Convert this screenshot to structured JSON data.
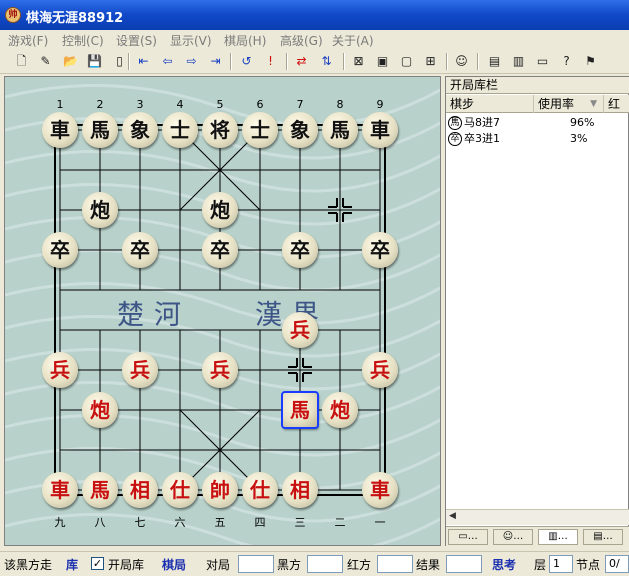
{
  "window": {
    "title": "棋海无涯88912",
    "app_icon_glyph": "帅"
  },
  "menu": [
    {
      "id": "game",
      "label": "游戏(F)"
    },
    {
      "id": "control",
      "label": "控制(C)"
    },
    {
      "id": "settings",
      "label": "设置(S)"
    },
    {
      "id": "view",
      "label": "显示(V)"
    },
    {
      "id": "layout",
      "label": "棋局(H)"
    },
    {
      "id": "advanced",
      "label": "高级(G)"
    },
    {
      "id": "about",
      "label": "关于(A)"
    }
  ],
  "toolbar": [
    {
      "id": "new",
      "icon": "new-doc-icon",
      "glyph": "🗋"
    },
    {
      "id": "edit",
      "icon": "edit-doc-icon",
      "glyph": "✎"
    },
    {
      "id": "open",
      "icon": "open-folder-icon",
      "glyph": "📂"
    },
    {
      "id": "save",
      "icon": "save-icon",
      "glyph": "💾"
    },
    {
      "id": "blank",
      "icon": "blank-page-icon",
      "glyph": "▯"
    },
    {
      "id": "first",
      "icon": "first-move-icon",
      "glyph": "⇤"
    },
    {
      "id": "prev",
      "icon": "prev-move-icon",
      "glyph": "⇦"
    },
    {
      "id": "next",
      "icon": "next-move-icon",
      "glyph": "⇨"
    },
    {
      "id": "last",
      "icon": "last-move-icon",
      "glyph": "⇥"
    },
    {
      "id": "undo",
      "icon": "undo-icon",
      "glyph": "↺"
    },
    {
      "id": "hint",
      "icon": "exclamation-icon",
      "glyph": "!"
    },
    {
      "id": "swap",
      "icon": "swap-icon",
      "glyph": "⇄"
    },
    {
      "id": "flip",
      "icon": "flip-icon",
      "glyph": "⇅"
    },
    {
      "id": "analysis",
      "icon": "analysis-icon",
      "glyph": "⊠"
    },
    {
      "id": "engine",
      "icon": "engine-icon",
      "glyph": "▣"
    },
    {
      "id": "monitor",
      "icon": "monitor-icon",
      "glyph": "▢"
    },
    {
      "id": "tree",
      "icon": "tree-icon",
      "glyph": "⊞"
    },
    {
      "id": "player",
      "icon": "player-icon",
      "glyph": "☺"
    },
    {
      "id": "record",
      "icon": "record-icon",
      "glyph": "▤"
    },
    {
      "id": "doc",
      "icon": "document-icon",
      "glyph": "▥"
    },
    {
      "id": "screen",
      "icon": "screen-icon",
      "glyph": "▭"
    },
    {
      "id": "help",
      "icon": "help-icon",
      "glyph": "?"
    },
    {
      "id": "run",
      "icon": "runner-icon",
      "glyph": "⚑"
    }
  ],
  "board": {
    "top_file_numbers": [
      "1",
      "2",
      "3",
      "4",
      "5",
      "6",
      "7",
      "8",
      "9"
    ],
    "bottom_file_numbers": [
      "九",
      "八",
      "七",
      "六",
      "五",
      "四",
      "三",
      "二",
      "一"
    ],
    "river_left": "楚河",
    "river_right": "漢界",
    "pieces": [
      {
        "col": 0,
        "row": 0,
        "label": "車",
        "side": "black"
      },
      {
        "col": 1,
        "row": 0,
        "label": "馬",
        "side": "black"
      },
      {
        "col": 2,
        "row": 0,
        "label": "象",
        "side": "black"
      },
      {
        "col": 3,
        "row": 0,
        "label": "士",
        "side": "black"
      },
      {
        "col": 4,
        "row": 0,
        "label": "将",
        "side": "black"
      },
      {
        "col": 5,
        "row": 0,
        "label": "士",
        "side": "black"
      },
      {
        "col": 6,
        "row": 0,
        "label": "象",
        "side": "black"
      },
      {
        "col": 7,
        "row": 0,
        "label": "馬",
        "side": "black"
      },
      {
        "col": 8,
        "row": 0,
        "label": "車",
        "side": "black"
      },
      {
        "col": 1,
        "row": 2,
        "label": "炮",
        "side": "black"
      },
      {
        "col": 4,
        "row": 2,
        "label": "炮",
        "side": "black"
      },
      {
        "col": 0,
        "row": 3,
        "label": "卒",
        "side": "black"
      },
      {
        "col": 2,
        "row": 3,
        "label": "卒",
        "side": "black"
      },
      {
        "col": 4,
        "row": 3,
        "label": "卒",
        "side": "black"
      },
      {
        "col": 6,
        "row": 3,
        "label": "卒",
        "side": "black"
      },
      {
        "col": 8,
        "row": 3,
        "label": "卒",
        "side": "black"
      },
      {
        "col": 6,
        "row": 5,
        "label": "兵",
        "side": "red"
      },
      {
        "col": 0,
        "row": 6,
        "label": "兵",
        "side": "red"
      },
      {
        "col": 2,
        "row": 6,
        "label": "兵",
        "side": "red"
      },
      {
        "col": 4,
        "row": 6,
        "label": "兵",
        "side": "red"
      },
      {
        "col": 8,
        "row": 6,
        "label": "兵",
        "side": "red"
      },
      {
        "col": 1,
        "row": 7,
        "label": "炮",
        "side": "red"
      },
      {
        "col": 6,
        "row": 7,
        "label": "馬",
        "side": "red",
        "selected": true
      },
      {
        "col": 7,
        "row": 7,
        "label": "炮",
        "side": "red"
      },
      {
        "col": 0,
        "row": 9,
        "label": "車",
        "side": "red"
      },
      {
        "col": 1,
        "row": 9,
        "label": "馬",
        "side": "red"
      },
      {
        "col": 2,
        "row": 9,
        "label": "相",
        "side": "red"
      },
      {
        "col": 3,
        "row": 9,
        "label": "仕",
        "side": "red"
      },
      {
        "col": 4,
        "row": 9,
        "label": "帥",
        "side": "red"
      },
      {
        "col": 5,
        "row": 9,
        "label": "仕",
        "side": "red"
      },
      {
        "col": 6,
        "row": 9,
        "label": "相",
        "side": "red"
      },
      {
        "col": 8,
        "row": 9,
        "label": "車",
        "side": "red"
      }
    ],
    "move_marks": [
      {
        "col": 7,
        "row": 2
      },
      {
        "col": 6,
        "row": 6
      }
    ]
  },
  "panel": {
    "title": "开局库栏",
    "columns": [
      "棋步",
      "使用率",
      "红"
    ],
    "rows": [
      {
        "icon_glyph": "馬",
        "move": "马8进7",
        "usage": "96%"
      },
      {
        "icon_glyph": "卒",
        "move": "卒3进1",
        "usage": "3%"
      }
    ],
    "tabs": [
      {
        "icon": "monitor-icon",
        "glyph": "▭…"
      },
      {
        "icon": "player-icon",
        "glyph": "☺…"
      },
      {
        "icon": "document-icon",
        "glyph": "▥…"
      },
      {
        "icon": "list-icon",
        "glyph": "▤…"
      }
    ]
  },
  "status": {
    "turn": "该黑方走",
    "library_tag": "库",
    "checkbox_label": "开局库",
    "checked": true,
    "layout_tag": "棋局",
    "opponent_label": "对局",
    "black_label": "黑方",
    "red_label": "红方",
    "result_label": "结果",
    "think_tag": "思考",
    "depth_label": "层",
    "depth_value": "1",
    "nodes_label": "节点",
    "nodes_value": "0/"
  }
}
